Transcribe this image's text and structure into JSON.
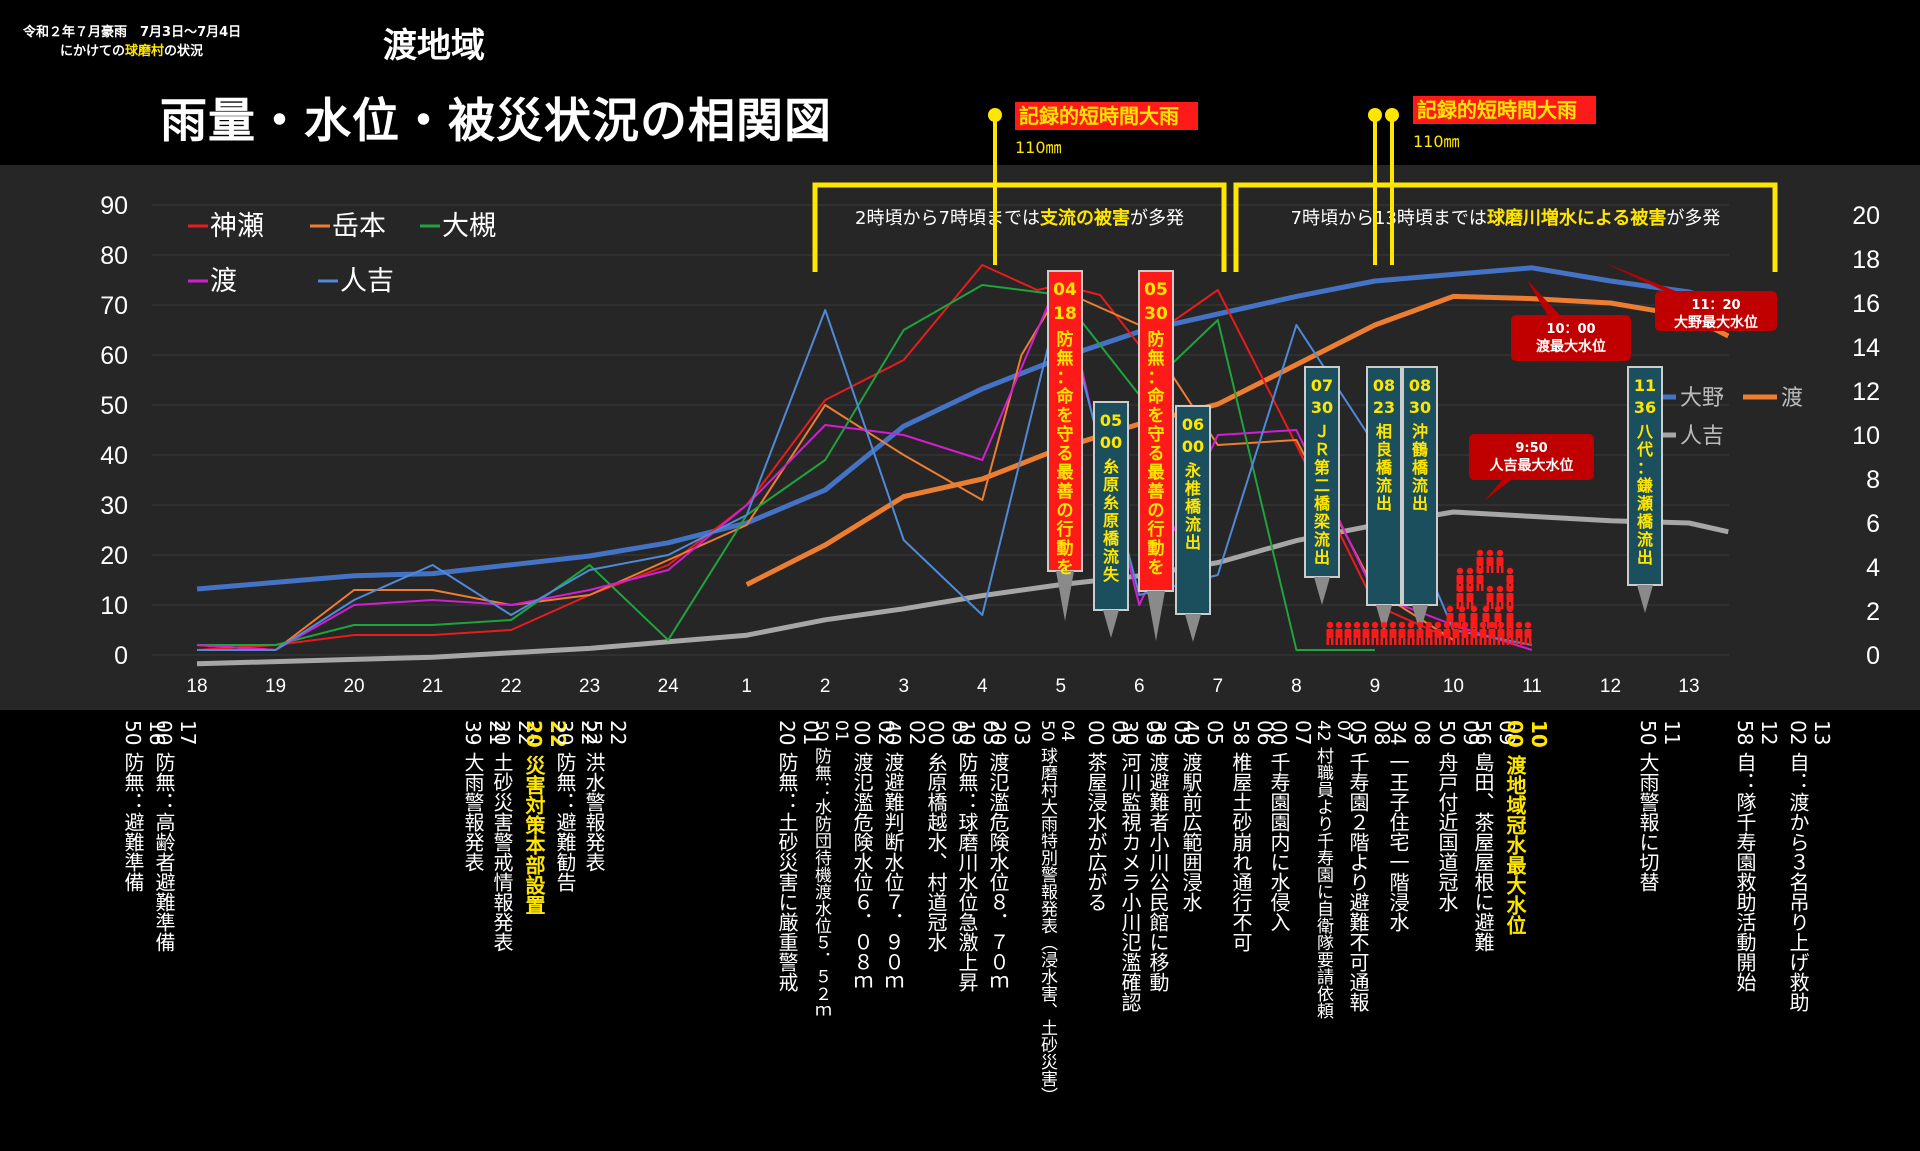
{
  "header": {
    "event_line": "令和２年７月豪雨　7月3日～7月4日",
    "status_line_prefix": "にかけての",
    "status_line_place": "球磨村",
    "status_line_suffix": "の状況",
    "area_title": "渡地域",
    "main_title": "雨量・水位・被災状況の相関図"
  },
  "rain_markers": [
    {
      "label": "記録的短時間大雨",
      "amount": "110㎜"
    },
    {
      "label": "記録的短時間大雨",
      "amount": "110㎜"
    }
  ],
  "period_notes": [
    {
      "prefix": "2時頃から7時頃までは",
      "highlight": "支流の被害",
      "suffix": "が多発"
    },
    {
      "prefix": "7時頃から13時頃までは",
      "highlight": "球磨川増水による被害",
      "suffix": "が多発"
    }
  ],
  "chart_data": {
    "type": "line",
    "x": [
      "18",
      "19",
      "20",
      "21",
      "22",
      "23",
      "24",
      "1",
      "2",
      "3",
      "4",
      "5",
      "6",
      "7",
      "8",
      "9",
      "10",
      "11",
      "12",
      "13"
    ],
    "left_axis": {
      "ticks": [
        "0",
        "10",
        "20",
        "30",
        "40",
        "50",
        "60",
        "70",
        "80",
        "90"
      ],
      "ylim": [
        0,
        90
      ]
    },
    "right_axis": {
      "ticks": [
        "0",
        "2",
        "4",
        "6",
        "8",
        "10",
        "12",
        "14",
        "16",
        "18",
        "20"
      ],
      "ylim": [
        0,
        20
      ]
    },
    "legend_left_colors": {
      "神瀬": "#e81c1c",
      "岳本": "#ed7d31",
      "大槻": "#1fa33c",
      "渡": "#d21ed2",
      "人吉": "#4f8ad8"
    },
    "legend_right_colors": {
      "大野": "#4472c4",
      "渡": "#ed7d31",
      "人吉": "#a6a6a6"
    },
    "rain_series": [
      {
        "name": "神瀬",
        "color": "#e81c1c",
        "points": [
          [
            0,
            1
          ],
          [
            1,
            2
          ],
          [
            2,
            4
          ],
          [
            3,
            4
          ],
          [
            4,
            5
          ],
          [
            5,
            12
          ],
          [
            6,
            18
          ],
          [
            7,
            30
          ],
          [
            8,
            51
          ],
          [
            9,
            59
          ],
          [
            10,
            78
          ],
          [
            10.7,
            73
          ],
          [
            11,
            74
          ],
          [
            11.5,
            72
          ],
          [
            12,
            62
          ],
          [
            13,
            73
          ],
          [
            14,
            42
          ],
          [
            15,
            10
          ],
          [
            16,
            3
          ]
        ]
      },
      {
        "name": "岳本",
        "color": "#ed7d31",
        "points": [
          [
            0,
            2
          ],
          [
            1,
            1
          ],
          [
            2,
            13
          ],
          [
            3,
            13
          ],
          [
            4,
            10
          ],
          [
            5,
            12
          ],
          [
            6,
            19
          ],
          [
            7,
            26
          ],
          [
            8,
            50
          ],
          [
            9,
            40
          ],
          [
            10,
            31
          ],
          [
            10.5,
            60
          ],
          [
            11,
            73
          ],
          [
            12,
            66
          ],
          [
            13,
            42
          ],
          [
            14,
            43
          ],
          [
            15,
            13
          ],
          [
            16,
            3
          ]
        ]
      },
      {
        "name": "大槻",
        "color": "#1fa33c",
        "points": [
          [
            0,
            2
          ],
          [
            1,
            2
          ],
          [
            2,
            6
          ],
          [
            3,
            6
          ],
          [
            4,
            7
          ],
          [
            5,
            18
          ],
          [
            6,
            3
          ],
          [
            7,
            28
          ],
          [
            8,
            39
          ],
          [
            9,
            65
          ],
          [
            10,
            74
          ],
          [
            11,
            72
          ],
          [
            12,
            52
          ],
          [
            13,
            67
          ],
          [
            14,
            1
          ],
          [
            15,
            1
          ]
        ]
      },
      {
        "name": "渡",
        "color": "#d21ed2",
        "points": [
          [
            0,
            2
          ],
          [
            1,
            1
          ],
          [
            2,
            10
          ],
          [
            3,
            11
          ],
          [
            4,
            10
          ],
          [
            5,
            13
          ],
          [
            6,
            17
          ],
          [
            7,
            30
          ],
          [
            8,
            46
          ],
          [
            9,
            44
          ],
          [
            10,
            39
          ],
          [
            11,
            76
          ],
          [
            11.4,
            48
          ],
          [
            12,
            10
          ],
          [
            13,
            44
          ],
          [
            14,
            45
          ],
          [
            15,
            12
          ],
          [
            16,
            6
          ],
          [
            17,
            1
          ]
        ]
      },
      {
        "name": "人吉",
        "color": "#4f8ad8",
        "points": [
          [
            0,
            1
          ],
          [
            1,
            1
          ],
          [
            2,
            11
          ],
          [
            3,
            18
          ],
          [
            4,
            8
          ],
          [
            5,
            17
          ],
          [
            6,
            20
          ],
          [
            7,
            28
          ],
          [
            8,
            69
          ],
          [
            9,
            23
          ],
          [
            10,
            8
          ],
          [
            11,
            72
          ],
          [
            12,
            12
          ],
          [
            13,
            16
          ],
          [
            14,
            66
          ],
          [
            15,
            42
          ],
          [
            16,
            5
          ],
          [
            17,
            2
          ]
        ]
      }
    ],
    "level_series": [
      {
        "name": "大野",
        "color": "#4472c4",
        "width": 5,
        "points": [
          [
            0,
            3
          ],
          [
            1,
            3.3
          ],
          [
            2,
            3.6
          ],
          [
            3,
            3.7
          ],
          [
            4,
            4.1
          ],
          [
            5,
            4.5
          ],
          [
            6,
            5.1
          ],
          [
            7,
            6.0
          ],
          [
            8,
            7.5
          ],
          [
            9,
            10.4
          ],
          [
            10,
            12.1
          ],
          [
            11,
            13.5
          ],
          [
            12,
            14.7
          ],
          [
            13,
            15.5
          ],
          [
            14,
            16.3
          ],
          [
            15,
            17.0
          ],
          [
            16,
            17.3
          ],
          [
            17,
            17.6
          ],
          [
            18,
            17.0
          ],
          [
            19,
            16.5
          ],
          [
            19.5,
            16.0
          ]
        ]
      },
      {
        "name": "渡",
        "color": "#ed7d31",
        "width": 5,
        "points": [
          [
            7,
            3.2
          ],
          [
            8,
            5.0
          ],
          [
            9,
            7.2
          ],
          [
            10,
            8.0
          ],
          [
            11,
            9.4
          ],
          [
            12,
            10.5
          ],
          [
            13,
            11.4
          ],
          [
            14,
            13.2
          ],
          [
            15,
            15.0
          ],
          [
            16,
            16.3
          ],
          [
            17,
            16.2
          ],
          [
            18,
            16.0
          ],
          [
            19,
            15.4
          ],
          [
            19.5,
            14.5
          ]
        ]
      },
      {
        "name": "人吉",
        "color": "#a6a6a6",
        "width": 5,
        "points": [
          [
            0,
            -0.4
          ],
          [
            1,
            -0.3
          ],
          [
            2,
            -0.2
          ],
          [
            3,
            -0.1
          ],
          [
            4,
            0.1
          ],
          [
            5,
            0.3
          ],
          [
            6,
            0.6
          ],
          [
            7,
            0.9
          ],
          [
            8,
            1.6
          ],
          [
            9,
            2.1
          ],
          [
            10,
            2.7
          ],
          [
            11,
            3.2
          ],
          [
            12,
            3.6
          ],
          [
            13,
            4.2
          ],
          [
            14,
            5.2
          ],
          [
            15,
            5.9
          ],
          [
            16,
            6.5
          ],
          [
            17,
            6.3
          ],
          [
            18,
            6.1
          ],
          [
            19,
            6.0
          ],
          [
            19.5,
            5.6
          ]
        ]
      }
    ],
    "callouts_red": [
      {
        "time_h": "04",
        "time_m": "18",
        "text": "防無：命を守る最善の行動を"
      },
      {
        "time_h": "05",
        "time_m": "30",
        "text": "防無：命を守る最善の行動を"
      }
    ],
    "callouts_teal": [
      {
        "time_h": "05",
        "time_m": "00",
        "text": "糸原糸原橋流失"
      },
      {
        "time_h": "06",
        "time_m": "00",
        "text": "永椎橋流出"
      },
      {
        "time_h": "07",
        "time_m": "30",
        "text": "ＪＲ第二橋梁流出"
      },
      {
        "time_h": "08",
        "time_m": "23",
        "text": "相良橋流出"
      },
      {
        "time_h": "08",
        "time_m": "30",
        "text": "沖鶴橋流出"
      },
      {
        "time_h": "11",
        "time_m": "36",
        "text": "八代：鎌瀬橋流出"
      }
    ],
    "peak_labels": [
      {
        "time": "9:50",
        "text": "人吉最大水位"
      },
      {
        "time": "10：00",
        "text": "渡最大水位"
      },
      {
        "time": "11：20",
        "text": "大野最大水位"
      }
    ]
  },
  "timeline": [
    {
      "time": "1650",
      "text": "防無：避難準備"
    },
    {
      "time": "1700",
      "text": "防無：高齢者避難準備"
    },
    {
      "time": "2139",
      "text": "大雨警報発表"
    },
    {
      "time": "2220",
      "text": "土砂災害警戒情報発表"
    },
    {
      "time": "2220",
      "text": "災害対策本部設置"
    },
    {
      "time": "2230",
      "text": "防無：避難勧告"
    },
    {
      "time": "2252",
      "text": "洪水警報発表"
    },
    {
      "time": "0120",
      "text": "防無：土砂災害に厳重警戒"
    },
    {
      "time": "0150",
      "text": "防無：水防団待機渡水位５．５２ｍ"
    },
    {
      "time": "0200",
      "text": "渡氾濫危険水位６．０８ｍ"
    },
    {
      "time": "0240",
      "text": "渡避難判断水位７．９０ｍ"
    },
    {
      "time": "0300",
      "text": "糸原橋越水、村道冠水"
    },
    {
      "time": "0310",
      "text": "防無：球磨川水位急激上昇"
    },
    {
      "time": "0320",
      "text": "渡氾濫危険水位８．７０ｍ"
    },
    {
      "time": "0450",
      "text": "球磨村大雨特別警報発表（浸水害、土砂災害）"
    },
    {
      "time": "0500",
      "text": "茶屋浸水が広がる"
    },
    {
      "time": "0530",
      "text": "河川監視カメラ小川氾濫確認"
    },
    {
      "time": "0530",
      "text": "渡避難者小川公民館に移動"
    },
    {
      "time": "0540",
      "text": "渡駅前広範囲浸水"
    },
    {
      "time": "0658",
      "text": "椎屋土砂崩れ通行不可"
    },
    {
      "time": "0700",
      "text": "千寿園園内に水侵入"
    },
    {
      "time": "0742",
      "text": "村職員より千寿園に自衛隊要請依頼"
    },
    {
      "time": "0805",
      "text": "千寿園２階より避難不可通報"
    },
    {
      "time": "0834",
      "text": "一王子住宅一階浸水"
    },
    {
      "time": "0950",
      "text": "舟戸付近国道冠水"
    },
    {
      "time": "0956",
      "text": "島田、茶屋屋根に避難"
    },
    {
      "time": "1000",
      "text": "渡地域冠水最大水位"
    },
    {
      "time": "1150",
      "text": "大雨警報に切替"
    },
    {
      "time": "1258",
      "text": "自：隊千寿園救助活動開始"
    },
    {
      "time": "1302",
      "text": "自：渡から３名吊り上げ救助"
    }
  ]
}
